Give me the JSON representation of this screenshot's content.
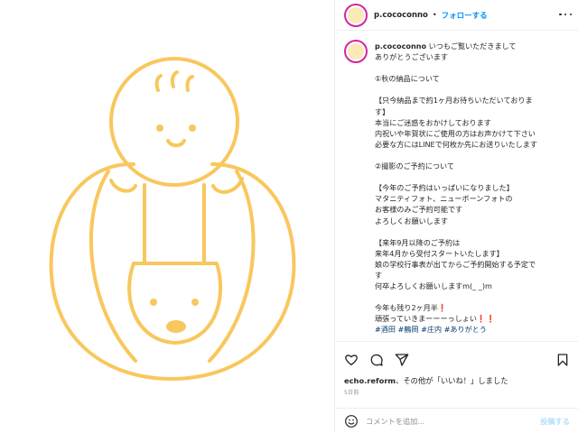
{
  "post": {
    "username": "p.cococonno",
    "follow_label": "フォローする",
    "separator": "•"
  },
  "caption": {
    "username": "p.cococonno",
    "text_lead": " いつもご覧いただきまして\nありがとうございます",
    "body": "\n①秋の納品について\n\n【只今納品まで約1ヶ月お待ちいただいておりま\nす】\n本当にご迷惑をおかけしております\n内祝いや年賀状にご使用の方はお声かけて下さい\n必要な方にはLINEで何枚か先にお送りいたします\n\n②撮影のご予約について\n\n【今年のご予約はいっぱいになりました】\nマタニティフォト、ニューボーンフォトの\nお客様のみご予約可能です\nよろしくお願いします\n\n【来年9月以降のご予約は\n来年4月から受付スタートいたします】\n娘の学校行事表が出てからご予約開始する予定で\nす\n何卒よろしくお願いしますm(_ _)m\n\n今年も残り2ヶ月半❗\n頑張っていきまーーーっしょい❗❗\n",
    "hashtags": "#酒田 #鶴岡 #庄内 #ありがとう"
  },
  "engagement": {
    "liked_by_user": "echo.reform",
    "liked_by_suffix": "、その他が「いいね！」しました",
    "date": "5日前"
  },
  "comment": {
    "placeholder": "コメントを追加...",
    "post_label": "投稿する"
  },
  "colors": {
    "illustration": "#f8c75d",
    "follow_blue": "#0095f6",
    "post_disabled": "#b2dffc"
  },
  "icons": [
    "heart-icon",
    "comment-icon",
    "share-icon",
    "bookmark-icon",
    "emoji-icon",
    "more-icon"
  ]
}
